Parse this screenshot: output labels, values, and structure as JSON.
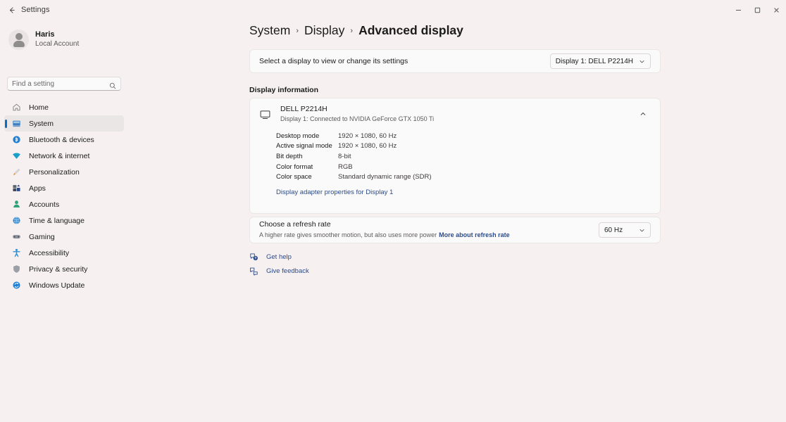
{
  "window": {
    "title": "Settings",
    "back_icon": "back-arrow-icon",
    "minimize_label": "Minimize",
    "maximize_label": "Maximize",
    "close_label": "Close"
  },
  "sidebar": {
    "profile": {
      "name": "Haris",
      "subtitle": "Local Account",
      "avatar_icon": "avatar-icon"
    },
    "search": {
      "placeholder": "Find a setting",
      "value": "",
      "icon": "search-icon"
    },
    "items": [
      {
        "label": "Home",
        "icon": "home-icon",
        "selected": false
      },
      {
        "label": "System",
        "icon": "system-icon",
        "selected": true
      },
      {
        "label": "Bluetooth & devices",
        "icon": "bluetooth-icon",
        "selected": false
      },
      {
        "label": "Network & internet",
        "icon": "network-icon",
        "selected": false
      },
      {
        "label": "Personalization",
        "icon": "personalization-icon",
        "selected": false
      },
      {
        "label": "Apps",
        "icon": "apps-icon",
        "selected": false
      },
      {
        "label": "Accounts",
        "icon": "accounts-icon",
        "selected": false
      },
      {
        "label": "Time & language",
        "icon": "time-icon",
        "selected": false
      },
      {
        "label": "Gaming",
        "icon": "gaming-icon",
        "selected": false
      },
      {
        "label": "Accessibility",
        "icon": "accessibility-icon",
        "selected": false
      },
      {
        "label": "Privacy & security",
        "icon": "privacy-icon",
        "selected": false
      },
      {
        "label": "Windows Update",
        "icon": "windows-update-icon",
        "selected": false
      }
    ]
  },
  "breadcrumb": {
    "item1": "System",
    "sep1": "›",
    "item2": "Display",
    "sep2": "›",
    "current": "Advanced display"
  },
  "display_selector": {
    "label": "Select a display to view or change its settings",
    "value": "Display 1: DELL P2214H",
    "chevron_icon": "chevron-down-icon"
  },
  "display_information": {
    "section_title": "Display information",
    "monitor_icon": "monitor-icon",
    "name": "DELL P2214H",
    "connection": "Display 1: Connected to NVIDIA GeForce GTX 1050 Ti",
    "expanded": true,
    "collapse_icon": "chevron-up-icon",
    "specs": [
      {
        "key": "Desktop mode",
        "value": "1920 × 1080, 60 Hz"
      },
      {
        "key": "Active signal mode",
        "value": "1920 × 1080, 60 Hz"
      },
      {
        "key": "Bit depth",
        "value": "8-bit"
      },
      {
        "key": "Color format",
        "value": "RGB"
      },
      {
        "key": "Color space",
        "value": "Standard dynamic range (SDR)"
      }
    ],
    "adapter_link": "Display adapter properties for Display 1"
  },
  "refresh_rate": {
    "title": "Choose a refresh rate",
    "description": "A higher rate gives smoother motion, but also uses more power",
    "link": "More about refresh rate",
    "value": "60 Hz",
    "chevron_icon": "chevron-down-icon"
  },
  "footer_links": [
    {
      "label": "Get help",
      "icon": "get-help-icon"
    },
    {
      "label": "Give feedback",
      "icon": "give-feedback-icon"
    }
  ],
  "colors": {
    "background": "#f6f0f0",
    "card": "#fbfafa",
    "accent": "#0f6cbd",
    "link": "#2b4b8c",
    "selected_row": "#ebe6e6"
  }
}
